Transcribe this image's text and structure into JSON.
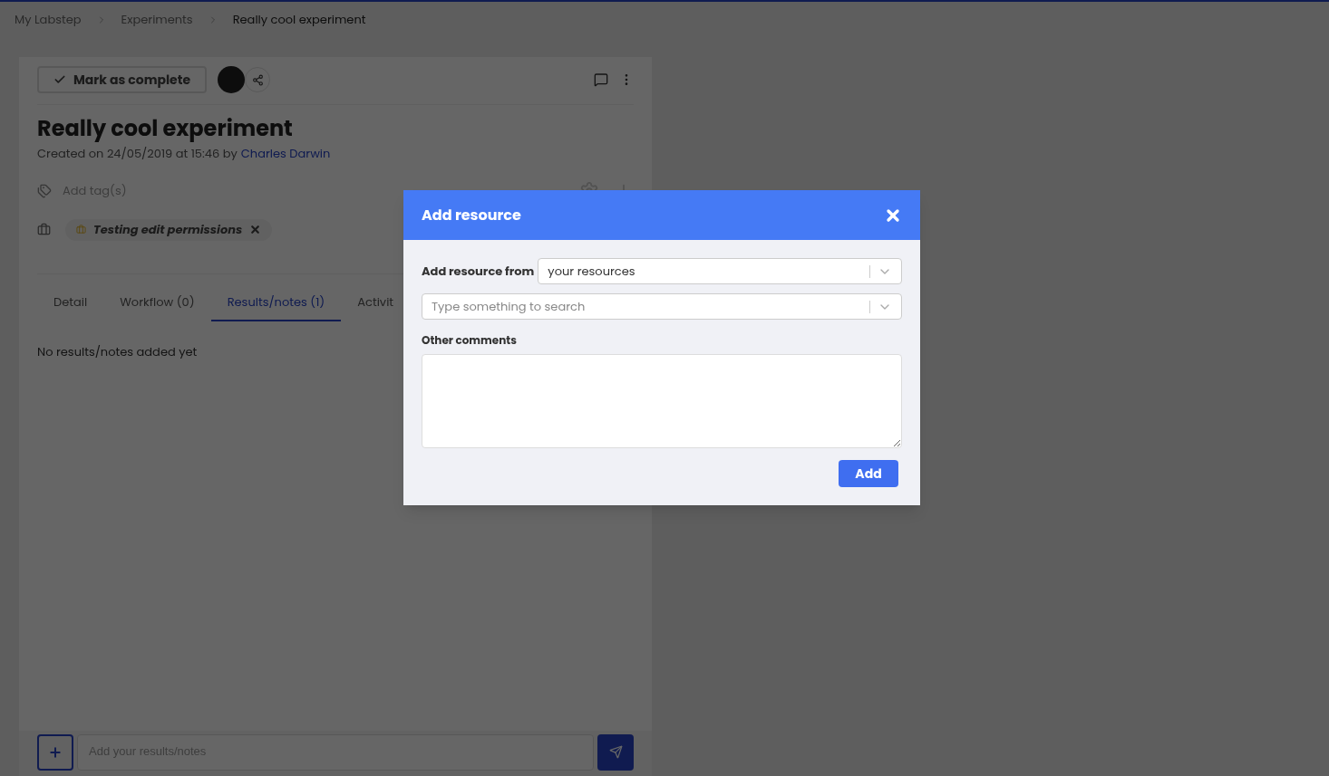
{
  "breadcrumbs": [
    {
      "label": "My Labstep"
    },
    {
      "label": "Experiments"
    },
    {
      "label": "Really cool experiment"
    }
  ],
  "header": {
    "complete_button": "Mark as complete"
  },
  "experiment": {
    "title": "Really cool experiment",
    "created": "Created on 24/05/2019 at 15:46 by",
    "author": "Charles Darwin"
  },
  "tags": {
    "placeholder": "Add tag(s)"
  },
  "project_tag": {
    "label": "Testing edit permissions"
  },
  "tabs": [
    {
      "label": "Detail",
      "selected": false
    },
    {
      "label": "Workflow (0)",
      "selected": false
    },
    {
      "label": "Results/notes (1)",
      "selected": true
    },
    {
      "label": "Activit",
      "selected": false
    }
  ],
  "empty_message": "No results/notes added yet",
  "composer": {
    "placeholder": "Add your results/notes"
  },
  "modal": {
    "title": "Add resource",
    "source_label": "Add resource from",
    "source_value": "your resources",
    "search_placeholder": "Type something to search",
    "comments_label": "Other comments",
    "add_button": "Add"
  }
}
